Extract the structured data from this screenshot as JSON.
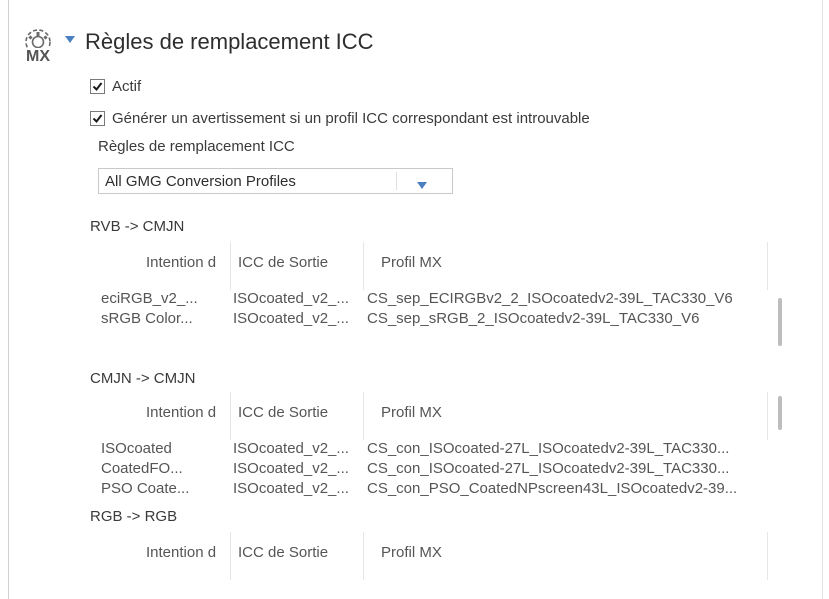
{
  "section": {
    "title": "Règles de remplacement ICC",
    "icon_text": "MX"
  },
  "active_checkbox": {
    "label": "Actif",
    "checked": true
  },
  "warning_checkbox": {
    "label": "Générer un avertissement si un profil ICC correspondant est introuvable",
    "checked": true
  },
  "rules_label": "Règles de remplacement ICC",
  "rules_select": {
    "value": "All GMG Conversion Profiles"
  },
  "columns": {
    "intent": "Intention d",
    "output": "ICC de Sortie",
    "profile": "Profil MX"
  },
  "groups": [
    {
      "title": "RVB -> CMJN",
      "rows": [
        {
          "intent": "eciRGB_v2_...",
          "output": "ISOcoated_v2_...",
          "profile": "CS_sep_ECIRGBv2_2_ISOcoatedv2-39L_TAC330_V6"
        },
        {
          "intent": "sRGB Color...",
          "output": "ISOcoated_v2_...",
          "profile": "CS_sep_sRGB_2_ISOcoatedv2-39L_TAC330_V6"
        }
      ]
    },
    {
      "title": "CMJN -> CMJN",
      "rows": [
        {
          "intent": "ISOcoated",
          "output": "ISOcoated_v2_...",
          "profile": "CS_con_ISOcoated-27L_ISOcoatedv2-39L_TAC330..."
        },
        {
          "intent": "CoatedFO...",
          "output": "ISOcoated_v2_...",
          "profile": "CS_con_ISOcoated-27L_ISOcoatedv2-39L_TAC330..."
        },
        {
          "intent": "PSO Coate...",
          "output": "ISOcoated_v2_...",
          "profile": "CS_con_PSO_CoatedNPscreen43L_ISOcoatedv2-39..."
        }
      ]
    },
    {
      "title": "RGB -> RGB",
      "rows": []
    }
  ],
  "colors": {
    "accent": "#4a7fc1",
    "text": "#3a3a3a",
    "muted": "#555555"
  }
}
